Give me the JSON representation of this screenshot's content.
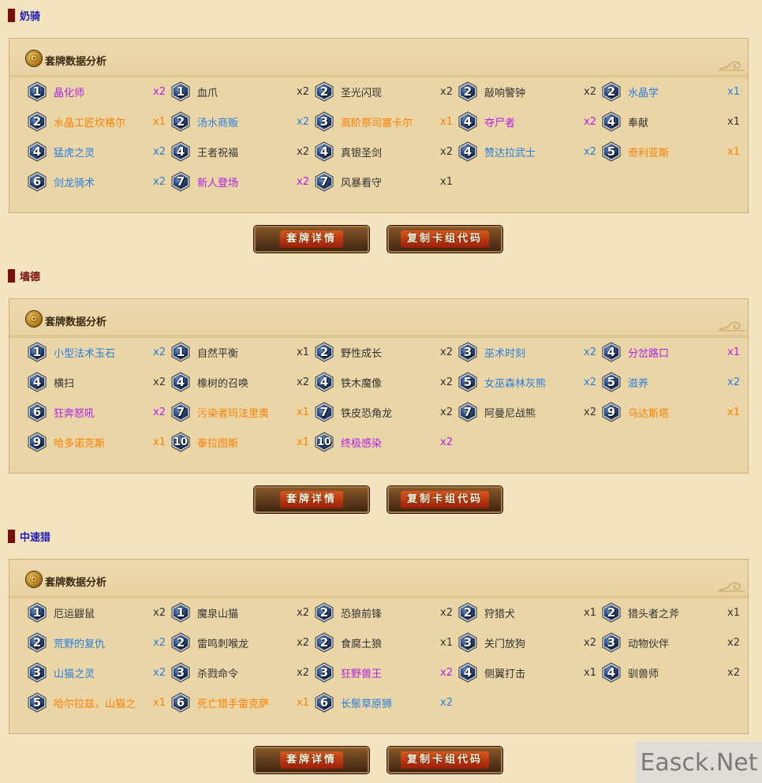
{
  "colors": {
    "legendary": "#ff8000",
    "epic": "#b51ee8",
    "rare": "#2a7ee0",
    "common": "#333333",
    "deck_title": "#1a1ab8",
    "deck_title_alt": "#7a0d0d"
  },
  "decks": [
    {
      "title": "奶骑",
      "panel_label": "套牌数据分析",
      "panel_icon": "hearthstone-logo-icon",
      "cards": [
        {
          "cost": "1",
          "name": "晶化师",
          "count": "x2",
          "rarity": "epic"
        },
        {
          "cost": "1",
          "name": "血爪",
          "count": "x2",
          "rarity": "common"
        },
        {
          "cost": "2",
          "name": "圣光闪现",
          "count": "x2",
          "rarity": "common"
        },
        {
          "cost": "2",
          "name": "敲响警钟",
          "count": "x2",
          "rarity": "common"
        },
        {
          "cost": "2",
          "name": "水晶学",
          "count": "x1",
          "rarity": "rare"
        },
        {
          "cost": "2",
          "name": "水晶工匠坎格尔",
          "count": "x1",
          "rarity": "legendary"
        },
        {
          "cost": "2",
          "name": "汤水商贩",
          "count": "x2",
          "rarity": "rare"
        },
        {
          "cost": "3",
          "name": "高阶祭司塞卡尔",
          "count": "x1",
          "rarity": "legendary"
        },
        {
          "cost": "4",
          "name": "夺尸者",
          "count": "x2",
          "rarity": "epic"
        },
        {
          "cost": "4",
          "name": "奉献",
          "count": "x1",
          "rarity": "common"
        },
        {
          "cost": "4",
          "name": "猛虎之灵",
          "count": "x2",
          "rarity": "rare"
        },
        {
          "cost": "4",
          "name": "王者祝福",
          "count": "x2",
          "rarity": "common"
        },
        {
          "cost": "4",
          "name": "真银圣剑",
          "count": "x2",
          "rarity": "common"
        },
        {
          "cost": "4",
          "name": "赞达拉武士",
          "count": "x2",
          "rarity": "rare"
        },
        {
          "cost": "5",
          "name": "奇利亚斯",
          "count": "x1",
          "rarity": "legendary"
        },
        {
          "cost": "6",
          "name": "剑龙骑术",
          "count": "x2",
          "rarity": "rare"
        },
        {
          "cost": "7",
          "name": "新人登场",
          "count": "x2",
          "rarity": "epic"
        },
        {
          "cost": "7",
          "name": "风暴看守",
          "count": "x1",
          "rarity": "common"
        }
      ],
      "buttons": {
        "details": "套牌详情",
        "copy": "复制卡组代码"
      }
    },
    {
      "title": "墙德",
      "panel_label": "套牌数据分析",
      "panel_icon": "hearthstone-logo-icon",
      "cards": [
        {
          "cost": "1",
          "name": "小型法术玉石",
          "count": "x2",
          "rarity": "rare"
        },
        {
          "cost": "1",
          "name": "自然平衡",
          "count": "x1",
          "rarity": "common"
        },
        {
          "cost": "2",
          "name": "野性成长",
          "count": "x2",
          "rarity": "common"
        },
        {
          "cost": "3",
          "name": "巫术时刻",
          "count": "x2",
          "rarity": "rare"
        },
        {
          "cost": "4",
          "name": "分岔路口",
          "count": "x1",
          "rarity": "epic"
        },
        {
          "cost": "4",
          "name": "横扫",
          "count": "x2",
          "rarity": "common"
        },
        {
          "cost": "4",
          "name": "橡树的召唤",
          "count": "x2",
          "rarity": "common"
        },
        {
          "cost": "4",
          "name": "铁木魔像",
          "count": "x2",
          "rarity": "common"
        },
        {
          "cost": "5",
          "name": "女巫森林灰熊",
          "count": "x2",
          "rarity": "rare"
        },
        {
          "cost": "5",
          "name": "滋养",
          "count": "x2",
          "rarity": "rare"
        },
        {
          "cost": "6",
          "name": "狂奔怒吼",
          "count": "x2",
          "rarity": "epic"
        },
        {
          "cost": "7",
          "name": "污染者玛法里奥",
          "count": "x1",
          "rarity": "legendary"
        },
        {
          "cost": "7",
          "name": "铁皮恐角龙",
          "count": "x2",
          "rarity": "common"
        },
        {
          "cost": "7",
          "name": "阿曼尼战熊",
          "count": "x2",
          "rarity": "common"
        },
        {
          "cost": "9",
          "name": "乌达斯塔",
          "count": "x1",
          "rarity": "legendary"
        },
        {
          "cost": "9",
          "name": "哈多诺克斯",
          "count": "x1",
          "rarity": "legendary"
        },
        {
          "cost": "10",
          "name": "泰拉图斯",
          "count": "x1",
          "rarity": "legendary"
        },
        {
          "cost": "10",
          "name": "终极感染",
          "count": "x2",
          "rarity": "epic"
        }
      ],
      "buttons": {
        "details": "套牌详情",
        "copy": "复制卡组代码"
      }
    },
    {
      "title": "中速猎",
      "panel_label": "套牌数据分析",
      "panel_icon": "hearthstone-logo-icon",
      "cards": [
        {
          "cost": "1",
          "name": "厄运鼹鼠",
          "count": "x2",
          "rarity": "common"
        },
        {
          "cost": "1",
          "name": "魔泉山猫",
          "count": "x2",
          "rarity": "common"
        },
        {
          "cost": "2",
          "name": "恐狼前锋",
          "count": "x2",
          "rarity": "common"
        },
        {
          "cost": "2",
          "name": "狩猎犬",
          "count": "x1",
          "rarity": "common"
        },
        {
          "cost": "2",
          "name": "猎头者之斧",
          "count": "x1",
          "rarity": "common"
        },
        {
          "cost": "2",
          "name": "荒野的复仇",
          "count": "x2",
          "rarity": "rare"
        },
        {
          "cost": "2",
          "name": "雷鸣刺喉龙",
          "count": "x2",
          "rarity": "common"
        },
        {
          "cost": "2",
          "name": "食腐土狼",
          "count": "x1",
          "rarity": "common"
        },
        {
          "cost": "3",
          "name": "关门放狗",
          "count": "x2",
          "rarity": "common"
        },
        {
          "cost": "3",
          "name": "动物伙伴",
          "count": "x2",
          "rarity": "common"
        },
        {
          "cost": "3",
          "name": "山猫之灵",
          "count": "x2",
          "rarity": "rare"
        },
        {
          "cost": "3",
          "name": "杀戮命令",
          "count": "x2",
          "rarity": "common"
        },
        {
          "cost": "3",
          "name": "狂野兽王",
          "count": "x2",
          "rarity": "epic"
        },
        {
          "cost": "4",
          "name": "侧翼打击",
          "count": "x1",
          "rarity": "common"
        },
        {
          "cost": "4",
          "name": "驯兽师",
          "count": "x2",
          "rarity": "common"
        },
        {
          "cost": "5",
          "name": "哈尔拉兹，山猫之",
          "count": "x1",
          "rarity": "legendary"
        },
        {
          "cost": "6",
          "name": "死亡猎手雷克萨",
          "count": "x1",
          "rarity": "legendary"
        },
        {
          "cost": "6",
          "name": "长鬃草原狮",
          "count": "x2",
          "rarity": "rare"
        }
      ],
      "buttons": {
        "details": "套牌详情",
        "copy": "复制卡组代码"
      }
    }
  ],
  "watermark": "Easck.Net"
}
